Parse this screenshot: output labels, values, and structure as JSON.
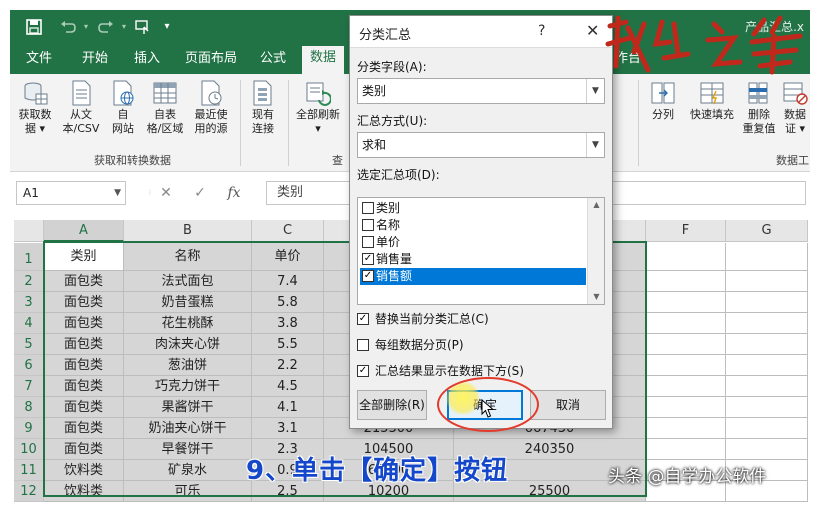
{
  "window": {
    "title_partial": "产品汇总.x",
    "quick_access": {
      "save_icon": "save-icon",
      "undo_icon": "undo-icon",
      "redo_icon": "redo-icon",
      "customize_icon": "customize-qat-icon"
    }
  },
  "tabs": [
    {
      "label": "文件"
    },
    {
      "label": "开始"
    },
    {
      "label": "插入"
    },
    {
      "label": "页面布局"
    },
    {
      "label": "公式"
    },
    {
      "label": "数据",
      "active": true
    },
    {
      "label": "作台"
    }
  ],
  "ribbon": {
    "get_transform": {
      "buttons": [
        {
          "label": "获取数\n据 ▾",
          "icon": "database-icon"
        },
        {
          "label": "从文\n本/CSV",
          "icon": "text-file-icon"
        },
        {
          "label": "自\n网站",
          "icon": "web-icon"
        },
        {
          "label": "自表\n格/区域",
          "icon": "table-icon"
        },
        {
          "label": "最近使\n用的源",
          "icon": "recent-sources-icon"
        },
        {
          "label": "现有\n连接",
          "icon": "connections-icon"
        }
      ],
      "group_label": "获取和转换数据"
    },
    "query": {
      "buttons": [
        {
          "label": "全部刷新\n▾",
          "icon": "refresh-icon"
        }
      ],
      "group_label_partial": "查"
    },
    "data_tools": {
      "buttons": [
        {
          "label": "分列",
          "icon": "text-to-columns-icon"
        },
        {
          "label": "快速填充",
          "icon": "flash-fill-icon"
        },
        {
          "label": "删除\n重复值",
          "icon": "remove-duplicates-icon"
        },
        {
          "label": "数据\n证 ▾",
          "icon": "data-validation-icon"
        }
      ],
      "group_label_partial": "数据工"
    }
  },
  "formula_bar": {
    "name_box": "A1",
    "cancel_symbol": "✕",
    "enter_symbol": "✓",
    "fx_symbol": "fx",
    "content": "类别"
  },
  "sheet": {
    "columns": [
      "A",
      "B",
      "C",
      "D",
      "E",
      "F",
      "G"
    ],
    "headers": [
      "类别",
      "名称",
      "单价"
    ],
    "rows": [
      {
        "n": "1",
        "a": "类别",
        "b": "名称",
        "c": "单价",
        "d": "",
        "e": ""
      },
      {
        "n": "2",
        "a": "面包类",
        "b": "法式面包",
        "c": "7.4",
        "d": "",
        "e": ""
      },
      {
        "n": "3",
        "a": "面包类",
        "b": "奶昔蛋糕",
        "c": "5.8",
        "d": "",
        "e": ""
      },
      {
        "n": "4",
        "a": "面包类",
        "b": "花生桃酥",
        "c": "3.8",
        "d": "",
        "e": ""
      },
      {
        "n": "5",
        "a": "面包类",
        "b": "肉沫夹心饼",
        "c": "5.5",
        "d": "",
        "e": ""
      },
      {
        "n": "6",
        "a": "面包类",
        "b": "葱油饼",
        "c": "2.2",
        "d": "",
        "e": ""
      },
      {
        "n": "7",
        "a": "面包类",
        "b": "巧克力饼干",
        "c": "4.5",
        "d": "",
        "e": ""
      },
      {
        "n": "8",
        "a": "面包类",
        "b": "果酱饼干",
        "c": "4.1",
        "d": "",
        "e": ""
      },
      {
        "n": "9",
        "a": "面包类",
        "b": "奶油夹心饼干",
        "c": "3.1",
        "d": "215300",
        "e": "667430"
      },
      {
        "n": "10",
        "a": "面包类",
        "b": "早餐饼干",
        "c": "2.3",
        "d": "104500",
        "e": "240350"
      },
      {
        "n": "11",
        "a": "饮料类",
        "b": "矿泉水",
        "c": "0.9",
        "d": "65000",
        "e": ""
      },
      {
        "n": "12",
        "a": "饮料类",
        "b": "可乐",
        "c": "2.5",
        "d": "10200",
        "e": "25500"
      }
    ]
  },
  "dialog": {
    "title": "分类汇总",
    "help": "?",
    "close": "✕",
    "group_field_label": "分类字段(A):",
    "group_field_value": "类别",
    "function_label": "汇总方式(U):",
    "function_value": "求和",
    "items_label": "选定汇总项(D):",
    "items": [
      {
        "label": "类别",
        "checked": false,
        "check_mark": "",
        "highlighted": false
      },
      {
        "label": "名称",
        "checked": false,
        "check_mark": "",
        "highlighted": false
      },
      {
        "label": "单价",
        "checked": false,
        "check_mark": "",
        "highlighted": false
      },
      {
        "label": "销售量",
        "checked": true,
        "check_mark": "✓",
        "highlighted": false
      },
      {
        "label": "销售额",
        "checked": true,
        "check_mark": "✓",
        "highlighted": true
      }
    ],
    "options": [
      {
        "label": "替换当前分类汇总(C)",
        "checked": true,
        "check_mark": "✓"
      },
      {
        "label": "每组数据分页(P)",
        "checked": false,
        "check_mark": ""
      },
      {
        "label": "汇总结果显示在数据下方(S)",
        "checked": true,
        "check_mark": "✓"
      }
    ],
    "remove_all_button": "全部删除(R)",
    "ok_button": "确定",
    "cancel_button": "取消"
  },
  "overlay": {
    "caption": "9、单击【确定】按钮",
    "watermark": "头条 @自学办公软件"
  },
  "colors": {
    "excel_green": "#217346",
    "selection_blue": "#0078d7",
    "annotation_red": "#e23b2e",
    "caption_blue": "#1447c9",
    "calligraphy_red": "#c0281c"
  }
}
